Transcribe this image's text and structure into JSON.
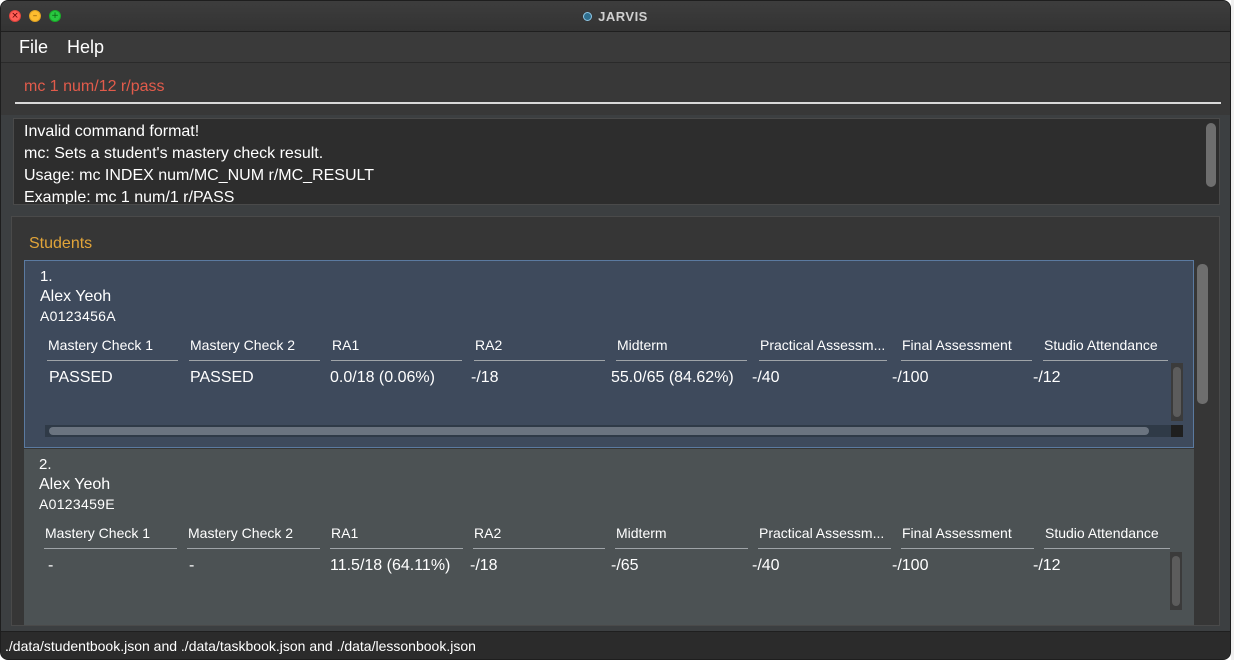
{
  "window": {
    "title": "JARVIS"
  },
  "menu": {
    "file": "File",
    "help": "Help"
  },
  "command": {
    "value": "mc 1 num/12 r/pass"
  },
  "result": {
    "lines": [
      "Invalid command format!",
      "mc: Sets a student's mastery check result.",
      "Usage: mc INDEX num/MC_NUM r/MC_RESULT",
      "Example: mc 1 num/1 r/PASS"
    ]
  },
  "students_panel": {
    "title": "Students"
  },
  "columns": [
    "Mastery Check 1",
    "Mastery Check 2",
    "RA1",
    "RA2",
    "Midterm",
    "Practical Assessm...",
    "Final Assessment",
    "Studio Attendance"
  ],
  "students": [
    {
      "index": "1.",
      "name": "Alex Yeoh",
      "matric": "A0123456A",
      "values": [
        "PASSED",
        "PASSED",
        "0.0/18 (0.06%)",
        "-/18",
        "55.0/65 (84.62%)",
        "-/40",
        "-/100",
        "-/12"
      ]
    },
    {
      "index": "2.",
      "name": "Alex Yeoh",
      "matric": "A0123459E",
      "values": [
        "-",
        "-",
        "11.5/18 (64.11%)",
        "-/18",
        "-/65",
        "-/40",
        "-/100",
        "-/12"
      ]
    }
  ],
  "status": {
    "path": "./data/studentbook.json and ./data/taskbook.json and ./data/lessonbook.json"
  },
  "colors": {
    "accent": "#e1a439",
    "command_text": "#e25b4b",
    "selected_card": "#3e4a5c"
  }
}
